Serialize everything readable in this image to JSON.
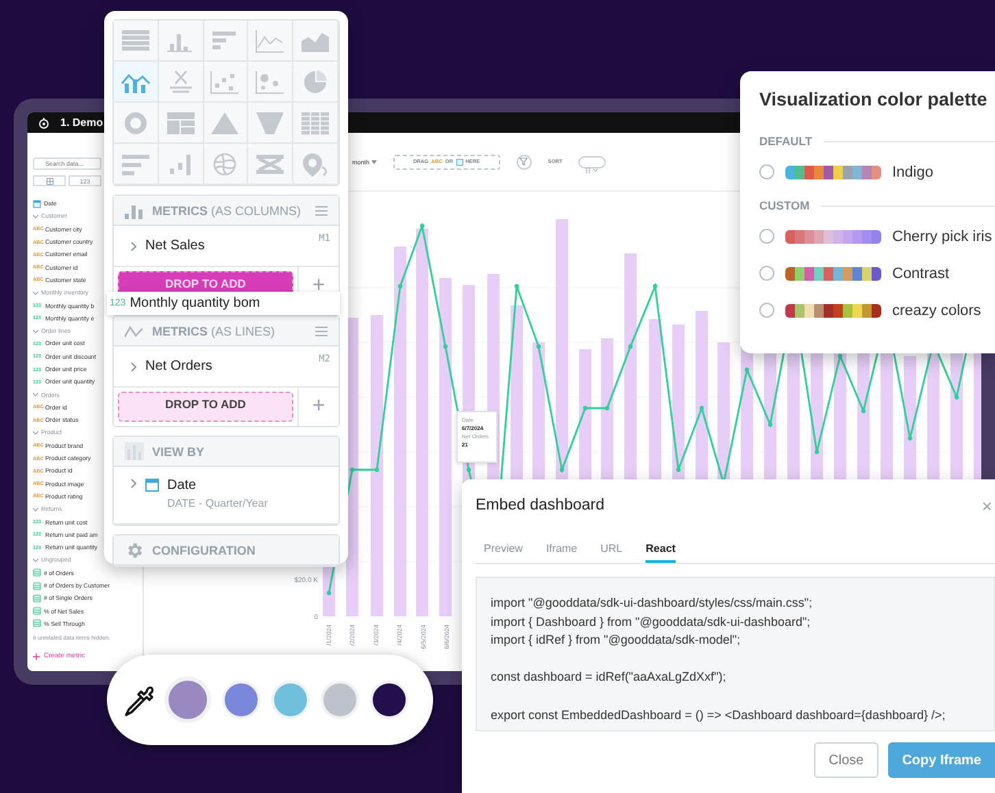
{
  "app": {
    "title": "1. Demo"
  },
  "sidebar": {
    "search": {
      "placeholder": "Search data..."
    },
    "type_filter": "123",
    "items": [
      {
        "kind": "date",
        "label": "Date"
      },
      {
        "kind": "group",
        "label": "Customer",
        "expanded": true,
        "children": [
          {
            "kind": "attribute",
            "badge": "ABC",
            "label": "Customer city"
          },
          {
            "kind": "attribute",
            "badge": "ABC",
            "label": "Customer country"
          },
          {
            "kind": "attribute",
            "badge": "ABC",
            "label": "Customer email"
          },
          {
            "kind": "attribute",
            "badge": "ABC",
            "label": "Customer id"
          },
          {
            "kind": "attribute",
            "badge": "ABC",
            "label": "Customer state"
          }
        ]
      },
      {
        "kind": "group",
        "label": "Monthly inventory",
        "expanded": true,
        "children": [
          {
            "kind": "fact",
            "badge": "123",
            "label": "Monthly quantity b"
          },
          {
            "kind": "fact",
            "badge": "123",
            "label": "Monthly quantity e"
          }
        ]
      },
      {
        "kind": "group",
        "label": "Order lines",
        "expanded": true,
        "children": [
          {
            "kind": "fact",
            "badge": "123",
            "label": "Order unit cost"
          },
          {
            "kind": "fact",
            "badge": "123",
            "label": "Order unit discount"
          },
          {
            "kind": "fact",
            "badge": "123",
            "label": "Order unit price"
          },
          {
            "kind": "fact",
            "badge": "123",
            "label": "Order unit quantity"
          }
        ]
      },
      {
        "kind": "group",
        "label": "Orders",
        "expanded": true,
        "children": [
          {
            "kind": "attribute",
            "badge": "ABC",
            "label": "Order id"
          },
          {
            "kind": "attribute",
            "badge": "ABC",
            "label": "Order status"
          }
        ]
      },
      {
        "kind": "group",
        "label": "Product",
        "expanded": true,
        "children": [
          {
            "kind": "attribute",
            "badge": "ABC",
            "label": "Product brand"
          },
          {
            "kind": "attribute",
            "badge": "ABC",
            "label": "Product category"
          },
          {
            "kind": "attribute",
            "badge": "ABC",
            "label": "Product id"
          },
          {
            "kind": "attribute",
            "badge": "ABC",
            "label": "Product image"
          },
          {
            "kind": "attribute",
            "badge": "ABC",
            "label": "Product rating"
          }
        ]
      },
      {
        "kind": "group",
        "label": "Returns",
        "expanded": true,
        "children": [
          {
            "kind": "fact",
            "badge": "123",
            "label": "Return unit cost"
          },
          {
            "kind": "fact",
            "badge": "123",
            "label": "Return unit paid am"
          },
          {
            "kind": "fact",
            "badge": "123",
            "label": "Return unit quantity"
          }
        ]
      },
      {
        "kind": "group",
        "label": "Ungrouped",
        "expanded": true,
        "children": [
          {
            "kind": "metric",
            "label": "# of Orders"
          },
          {
            "kind": "metric",
            "label": "# of Orders by Customer"
          },
          {
            "kind": "metric",
            "label": "# of Single Orders"
          },
          {
            "kind": "metric",
            "label": "% of Net Sales"
          },
          {
            "kind": "metric",
            "label": "% Sell Through"
          }
        ]
      }
    ],
    "hidden_note": "6 unrelated data items hidden.",
    "create_metric": "Create metric"
  },
  "toolbar": {
    "granularity": "month",
    "drop_hint": {
      "prefix": "DRAG",
      "badge": "ABC",
      "conjunction": "OR",
      "suffix": "HERE"
    },
    "sort_label": "SORT"
  },
  "chart": {
    "y_ticks": [
      "$20.0 K",
      "0"
    ],
    "x_labels": [
      "/1/2024",
      "/2/2024",
      "/3/2024",
      "/4/2024",
      "6/5/2024",
      "6/6/2024"
    ],
    "tooltip": {
      "date_label": "Date",
      "date": "6/7/2024",
      "metric_label": "Net Orders",
      "value": "21"
    }
  },
  "bucket_panel": {
    "chart_types": [
      {
        "selected": false
      },
      {
        "selected": false
      },
      {
        "selected": false
      },
      {
        "selected": false
      },
      {
        "selected": false
      },
      {
        "selected": true
      },
      {
        "selected": false
      },
      {
        "selected": false
      },
      {
        "selected": false
      },
      {
        "selected": false
      },
      {
        "selected": false
      },
      {
        "selected": false
      },
      {
        "selected": false
      },
      {
        "selected": false
      },
      {
        "selected": false
      },
      {
        "selected": false
      },
      {
        "selected": false
      },
      {
        "selected": false
      },
      {
        "selected": false
      },
      {
        "selected": false
      }
    ],
    "sections": [
      {
        "kind": "columns",
        "title": "**METRICS** (AS COLUMNS)",
        "items": [
          {
            "label": "Net Sales",
            "code": "M1"
          }
        ],
        "drop": {
          "label": "DROP TO ADD",
          "active": true
        },
        "add": "+"
      },
      {
        "kind": "lines",
        "title": "**METRICS** (AS LINES)",
        "items": [
          {
            "label": "Net Orders",
            "code": "M2"
          }
        ],
        "drop": {
          "label": "DROP TO ADD",
          "active": false
        },
        "add": "+"
      },
      {
        "kind": "view",
        "title": "**VIEW BY**",
        "items": [
          {
            "label": "Date",
            "detail": "DATE - Quarter/Year"
          }
        ]
      },
      {
        "kind": "config",
        "title": "**CONFIGURATION**"
      }
    ],
    "dragged_item": {
      "badge": "123",
      "label": "Monthly quantity bom"
    }
  },
  "palette_dialog": {
    "title": "Visualization color palette",
    "groups": [
      {
        "title": "DEFAULT",
        "palettes": [
          {
            "name": "Indigo",
            "selected": false,
            "colors": [
              {
                "color": "#4bb3e0"
              },
              {
                "color": "#4fbf8f"
              },
              {
                "color": "#df5a4a"
              },
              {
                "color": "#e8893a"
              },
              {
                "color": "#a05aa8"
              },
              {
                "color": "#f0cf45"
              },
              {
                "color": "#9aa3ad"
              },
              {
                "color": "#7fb6d6"
              },
              {
                "color": "#b685b5"
              },
              {
                "color": "#e59080"
              }
            ]
          }
        ]
      },
      {
        "title": "CUSTOM",
        "palettes": [
          {
            "name": "Cherry pick iris",
            "selected": false,
            "colors": [
              {
                "color": "#d9605f"
              },
              {
                "color": "#d97878"
              },
              {
                "color": "#db8f96"
              },
              {
                "color": "#dea6b0"
              },
              {
                "color": "#dcbfd8"
              },
              {
                "color": "#d3b3e6"
              },
              {
                "color": "#c3a6ec"
              },
              {
                "color": "#b39af0"
              },
              {
                "color": "#a38ef0"
              },
              {
                "color": "#9382ef"
              }
            ]
          },
          {
            "name": "Contrast",
            "selected": false,
            "colors": [
              {
                "color": "#c0602a"
              },
              {
                "color": "#8fd06a"
              },
              {
                "color": "#d65ea8"
              },
              {
                "color": "#6fd3c0"
              },
              {
                "color": "#d9625c"
              },
              {
                "color": "#72b5d8"
              },
              {
                "color": "#d59a60"
              },
              {
                "color": "#5d87d6"
              },
              {
                "color": "#d8d46a"
              },
              {
                "color": "#6e58cf"
              }
            ]
          },
          {
            "name": "creazy colors",
            "selected": false,
            "colors": [
              {
                "color": "#c2384c"
              },
              {
                "color": "#a9c46a"
              },
              {
                "color": "#f3dcb0"
              },
              {
                "color": "#b89270"
              },
              {
                "color": "#a3302a"
              },
              {
                "color": "#c1401e"
              },
              {
                "color": "#a9c040"
              },
              {
                "color": "#eed850"
              },
              {
                "color": "#c09a30"
              },
              {
                "color": "#a8301a"
              }
            ]
          }
        ]
      }
    ]
  },
  "embed_dialog": {
    "title": "Embed dashboard",
    "close": "×",
    "tabs": [
      {
        "label": "Preview",
        "selected": false
      },
      {
        "label": "Iframe",
        "selected": false
      },
      {
        "label": "URL",
        "selected": false
      },
      {
        "label": "React",
        "selected": true
      }
    ],
    "code_blocks": [
      [
        "import \"@gooddata/sdk-ui-dashboard/styles/css/main.css\";",
        "import { Dashboard } from \"@gooddata/sdk-ui-dashboard\";",
        "import { idRef } from \"@gooddata/sdk-model\";"
      ],
      [
        "const dashboard = idRef(\"aaAxaLgZdXxf\");"
      ],
      [
        "export const EmbeddedDashboard = () => <Dashboard dashboard={dashboard} />;"
      ]
    ],
    "buttons": [
      {
        "label": "Close",
        "kind": "secondary"
      },
      {
        "label": "Copy Iframe",
        "kind": "primary"
      }
    ]
  },
  "color_picker": {
    "swatches": [
      {
        "color": "#9a88c0",
        "selected": true
      },
      {
        "color": "#7a88dc",
        "selected": false
      },
      {
        "color": "#6fc0dc",
        "selected": false
      },
      {
        "color": "#bcc3cb",
        "selected": false
      },
      {
        "color": "#230f4d",
        "selected": false
      }
    ]
  }
}
